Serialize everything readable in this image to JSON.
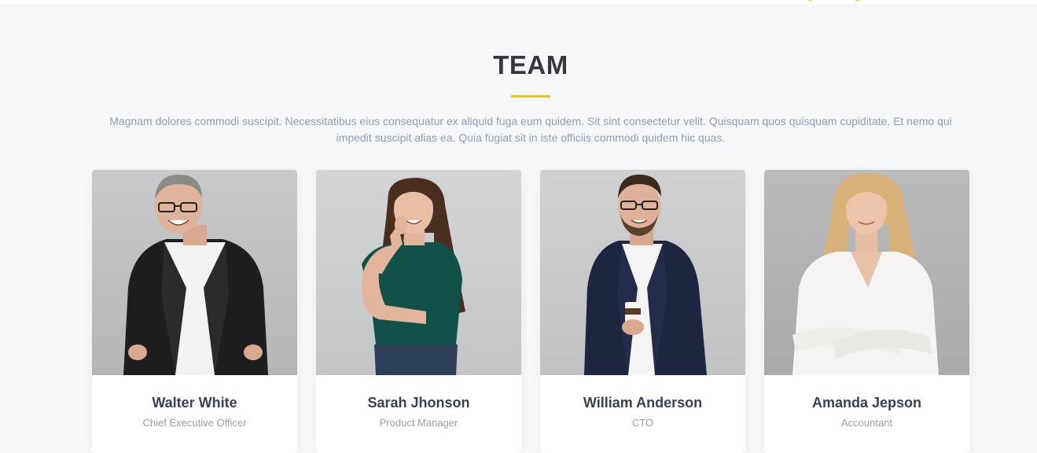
{
  "section": {
    "title": "TEAM",
    "description": "Magnam dolores commodi suscipit. Necessitatibus eius consequatur ex aliquid fuga eum quidem. Sit sint consectetur velit. Quisquam quos quisquam cupiditate. Et nemo qui impedit suscipit alias ea. Quia fugiat sit in iste officiis commodi quidem hic quas."
  },
  "colors": {
    "accent": "#f2c40f",
    "title": "#37373f",
    "description": "#8f9fb3",
    "name": "#3a3f54",
    "role": "#9a9ea6",
    "background": "#f6f7f9"
  },
  "team": [
    {
      "name": "Walter White",
      "role": "Chief Executive Officer"
    },
    {
      "name": "Sarah Jhonson",
      "role": "Product Manager"
    },
    {
      "name": "William Anderson",
      "role": "CTO"
    },
    {
      "name": "Amanda Jepson",
      "role": "Accountant"
    }
  ]
}
